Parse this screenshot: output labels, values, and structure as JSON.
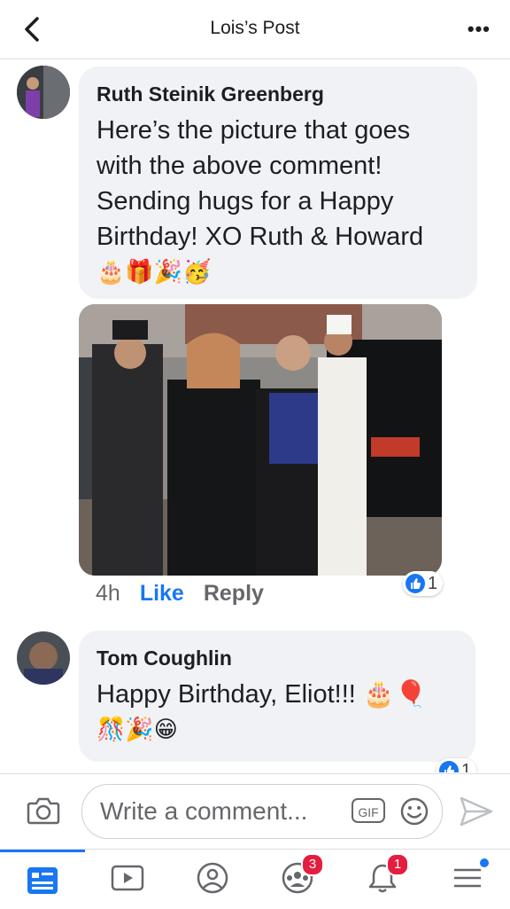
{
  "header": {
    "title": "Lois’s Post",
    "back_icon": "chevron-left-icon",
    "more_label": "•••"
  },
  "comments": [
    {
      "author": "Ruth Steinik Greenberg",
      "text_lines": [
        "Here’s the picture that goes",
        "with the above comment!",
        "Sending hugs for a Happy",
        "Birthday! XO Ruth & Howard"
      ],
      "emojis": "🎂🎁🎉🥳",
      "time": "4h",
      "like": "Like",
      "reply": "Reply",
      "reaction_count": "1"
    },
    {
      "author": "Tom Coughlin",
      "text_line1": "Happy Birthday, Eliot!!! 🎂🎈",
      "text_line2": "🎊🎉😁",
      "reaction_count": "1"
    }
  ],
  "composer": {
    "placeholder": "Write a comment...",
    "gif_label": "GIF"
  },
  "tabbar": {
    "groups_badge": "3",
    "notifications_badge": "1"
  },
  "colors": {
    "accent": "#1877f2",
    "bubble": "#f0f2f5",
    "badge": "#e41e3f"
  }
}
